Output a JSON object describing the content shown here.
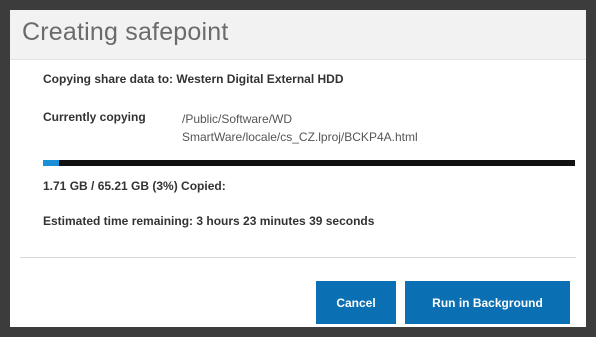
{
  "dialog": {
    "title": "Creating safepoint",
    "copying_to_label": "Copying share data to:  Western Digital External HDD",
    "currently_copying_label": "Currently copying",
    "current_path": "/Public/Software/WD\nSmartWare/locale/cs_CZ.lproj/BCKP4A.html",
    "progress_percent": 3,
    "progress_text": "1.71 GB  /  65.21 GB (3%)  Copied:",
    "time_remaining_text": "Estimated time remaining: 3 hours 23 minutes 39 seconds",
    "cancel_label": "Cancel",
    "background_label": "Run in Background"
  },
  "colors": {
    "accent": "#0b6fb3",
    "progress_fill": "#1a8fd8",
    "progress_track": "#111111"
  }
}
